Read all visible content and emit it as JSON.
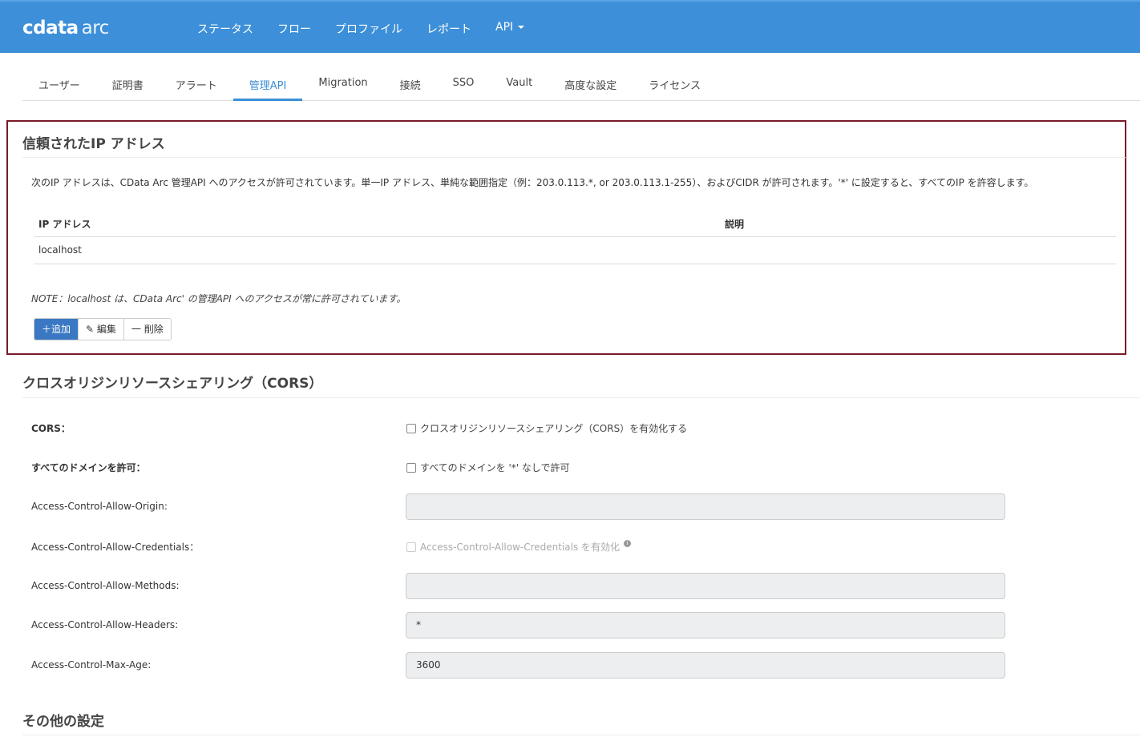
{
  "header": {
    "logo_bold": "cdata",
    "logo_light": "arc",
    "nav": [
      "ステータス",
      "フロー",
      "プロファイル",
      "レポート",
      "API"
    ]
  },
  "tabs": [
    "ユーザー",
    "証明書",
    "アラート",
    "管理API",
    "Migration",
    "接続",
    "SSO",
    "Vault",
    "高度な設定",
    "ライセンス"
  ],
  "trusted": {
    "title": "信頼されたIP アドレス",
    "description": "次のIP アドレスは、CData Arc 管理API へのアクセスが許可されています。単一IP アドレス、単純な範囲指定（例：203.0.113.*, or 203.0.113.1-255）、およびCIDR が許可されます。'*' に設定すると、すべてのIP を許容します。",
    "col_ip": "IP アドレス",
    "col_desc": "説明",
    "rows": [
      {
        "ip": "localhost",
        "desc": ""
      }
    ],
    "note": "NOTE：localhost は、CData Arc' の管理API へのアクセスが常に許可されています。",
    "add": "＋追加",
    "edit": "編集",
    "delete": "一 削除"
  },
  "cors": {
    "title": "クロスオリジンリソースシェアリング（CORS）",
    "cors_label": "CORS：",
    "cors_check": "クロスオリジンリソースシェアリング（CORS）を有効化する",
    "all_label": "すべてのドメインを許可：",
    "all_check": "すべてのドメインを '*' なしで許可",
    "origin_label": "Access-Control-Allow-Origin:",
    "origin_value": "",
    "cred_label": "Access-Control-Allow-Credentials：",
    "cred_check": "Access-Control-Allow-Credentials を有効化",
    "methods_label": "Access-Control-Allow-Methods:",
    "methods_value": "",
    "headers_label": "Access-Control-Allow-Headers:",
    "headers_value": "*",
    "maxage_label": "Access-Control-Max-Age:",
    "maxage_value": "3600"
  },
  "other": {
    "title": "その他の設定"
  }
}
